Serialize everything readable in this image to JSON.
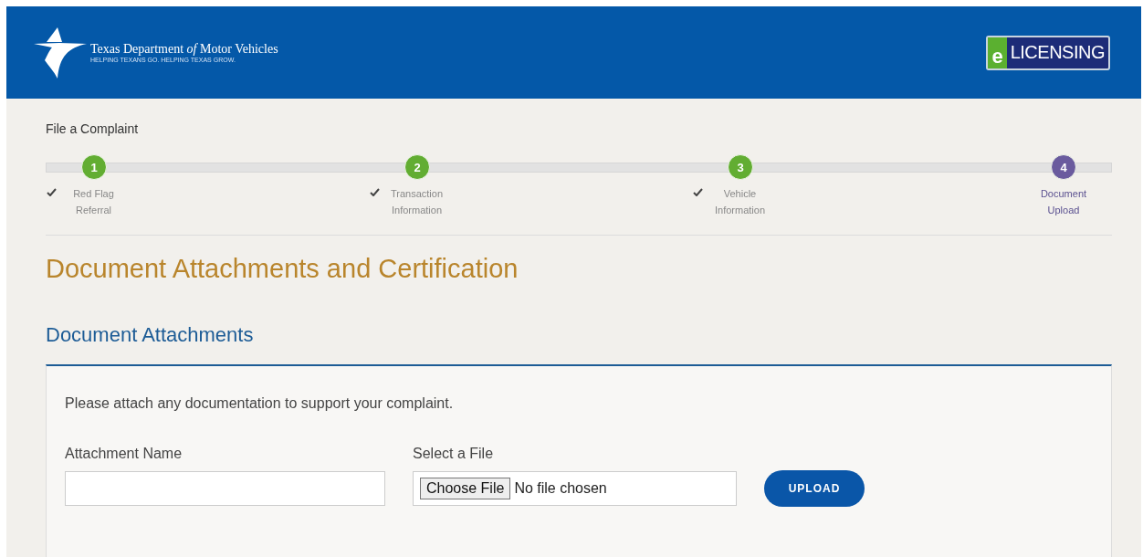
{
  "header": {
    "agency_name": "Texas Department *of* Motor Vehicles",
    "tagline": "HELPING TEXANS GO. HELPING TEXAS GROW.",
    "badge_letter": "e",
    "badge_text": "LICENSING"
  },
  "breadcrumb": "File a Complaint",
  "steps": [
    {
      "number": "1",
      "label": "Red Flag Referral",
      "completed": true,
      "selected": false
    },
    {
      "number": "2",
      "label": "Transaction Information",
      "completed": true,
      "selected": false
    },
    {
      "number": "3",
      "label": "Vehicle Information",
      "completed": true,
      "selected": false
    },
    {
      "number": "4",
      "label": "Document Upload",
      "completed": false,
      "selected": true
    }
  ],
  "page_title": "Document Attachments and Certification",
  "section_title": "Document Attachments",
  "panel": {
    "instructions": "Please attach any documentation to support your complaint.",
    "name_label": "Attachment Name",
    "file_label": "Select a File",
    "choose_button": "Choose File",
    "file_status": "No file chosen",
    "upload_button": "UPLOAD"
  }
}
